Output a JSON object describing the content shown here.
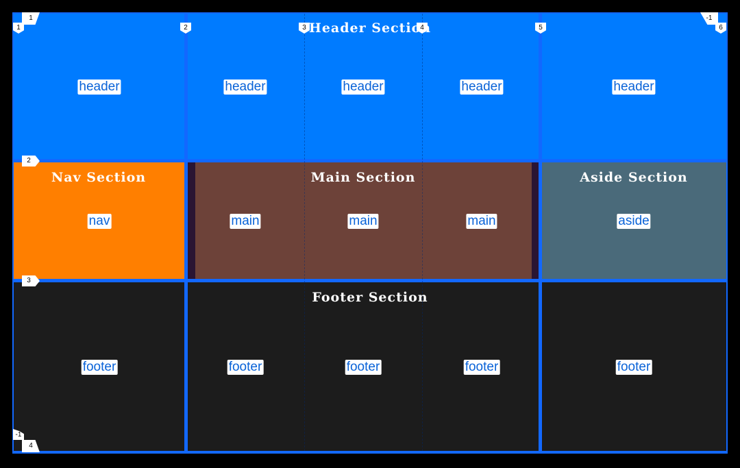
{
  "colors": {
    "header": "#007bff",
    "nav": "#ff7f00",
    "main": "#6d4239",
    "main_gutter": "#2a1533",
    "aside": "#4a6a7a",
    "footer": "#1c1c1c",
    "grid_line": "#1268ff",
    "label_text": "#0a63d8"
  },
  "sections": {
    "header_title": "Header Section",
    "nav_title": "Nav Section",
    "main_title": "Main Section",
    "aside_title": "Aside Section",
    "footer_title": "Footer Section"
  },
  "areas": {
    "header": [
      "header",
      "header",
      "header",
      "header",
      "header"
    ],
    "nav": "nav",
    "main": [
      "main",
      "main",
      "main"
    ],
    "aside": "aside",
    "footer": [
      "footer",
      "footer",
      "footer",
      "footer",
      "footer"
    ]
  },
  "grid_line_numbers": {
    "columns": [
      "1",
      "2",
      "3",
      "4",
      "5",
      "6"
    ],
    "columns_negative": [
      "-1"
    ],
    "rows": [
      "1",
      "2",
      "3",
      "4"
    ],
    "rows_negative": [
      "-1"
    ]
  }
}
